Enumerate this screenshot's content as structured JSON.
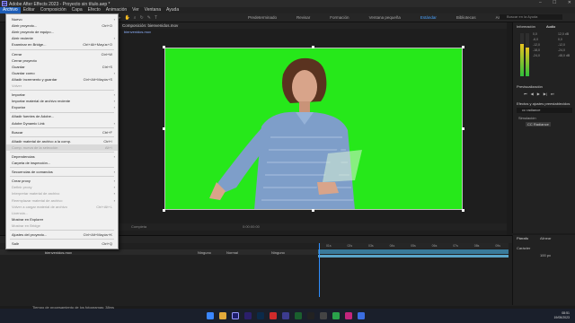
{
  "app": {
    "window_title": "Adobe After Effects 2023 - Proyecto sin título.aep *",
    "logo_text": "Ae"
  },
  "menubar": [
    "Archivo",
    "Editar",
    "Composición",
    "Capa",
    "Efecto",
    "Animación",
    "Ver",
    "Ventana",
    "Ayuda"
  ],
  "workspaces": [
    "Predeterminado",
    "Revisar",
    "Formación",
    "Ventana pequeña",
    "Estándar",
    "Bibliotecas",
    "Animación Mediapipe",
    "Tagging"
  ],
  "active_workspace_index": 4,
  "search_placeholder": "Buscar en la Ayuda",
  "composition": {
    "tab": "Composición: bienvenidos.mov",
    "sub": "bienvenidos.mov",
    "zoom": "Completa",
    "timecode": "0:00:00:00"
  },
  "right_panels": {
    "info_tab": "Información",
    "audio_tab": "Audio",
    "audio_scale": [
      "0,0",
      "-3,0",
      "-6,0",
      "-9,0",
      "-12,0",
      "-15,0",
      "-18,0",
      "-21,0",
      "-24,0"
    ],
    "audio_scale_right": [
      "12,0 dB",
      "0,0",
      "-12,0",
      "-24,0",
      "-36,0",
      "-48,0 dB"
    ],
    "preview_tab": "Previsualización",
    "effects_tab": "Efectos y ajustes preestablecidos",
    "effects_search": "cc radiance",
    "effect_group": "Simulación",
    "effect_item": "CC Radiance"
  },
  "timeline": {
    "layer_name": "bienvenidos.mov",
    "col_labels": [
      "Ninguno",
      "Normal",
      "Ninguno"
    ],
    "status_text": "Tiempo de procesamiento de los fotogramas: 38ms",
    "ruler": [
      "01s",
      "02s",
      "03s",
      "04s",
      "05s",
      "06s",
      "07s",
      "08s",
      "09s"
    ]
  },
  "right_bottom": {
    "tab1": "Párrafo",
    "tab2": "Alinear",
    "tab3": "Carácter",
    "val": "100 px"
  },
  "clock": {
    "time": "08:51",
    "date": "19/05/2023"
  },
  "file_menu": [
    {
      "label": "Nuevo",
      "sc": "",
      "arrow": true,
      "dis": false
    },
    {
      "label": "Abrir proyecto...",
      "sc": "Ctrl+O",
      "arrow": false,
      "dis": false
    },
    {
      "label": "Abrir proyecto de equipo...",
      "sc": "",
      "arrow": false,
      "dis": false
    },
    {
      "label": "Abrir reciente",
      "sc": "",
      "arrow": true,
      "dis": false
    },
    {
      "label": "Examinar en Bridge...",
      "sc": "Ctrl+Alt+Mayús+O",
      "arrow": false,
      "dis": false
    },
    {
      "sep": true
    },
    {
      "label": "Cerrar",
      "sc": "Ctrl+W",
      "arrow": false,
      "dis": false
    },
    {
      "label": "Cerrar proyecto",
      "sc": "",
      "arrow": false,
      "dis": false
    },
    {
      "label": "Guardar",
      "sc": "Ctrl+S",
      "arrow": false,
      "dis": false
    },
    {
      "label": "Guardar como",
      "sc": "",
      "arrow": true,
      "dis": false
    },
    {
      "label": "Añadir incremento y guardar",
      "sc": "Ctrl+Alt+Mayús+S",
      "arrow": false,
      "dis": false
    },
    {
      "label": "Volver",
      "sc": "",
      "arrow": false,
      "dis": true
    },
    {
      "sep": true
    },
    {
      "label": "Importar",
      "sc": "",
      "arrow": true,
      "dis": false
    },
    {
      "label": "Importar material de archivo reciente",
      "sc": "",
      "arrow": true,
      "dis": false
    },
    {
      "label": "Exportar",
      "sc": "",
      "arrow": true,
      "dis": false
    },
    {
      "sep": true
    },
    {
      "label": "Añadir fuentes de Adobe...",
      "sc": "",
      "arrow": false,
      "dis": false
    },
    {
      "label": "Adobe Dynamic Link",
      "sc": "",
      "arrow": true,
      "dis": false
    },
    {
      "sep": true
    },
    {
      "label": "Buscar",
      "sc": "Ctrl+F",
      "arrow": false,
      "dis": false
    },
    {
      "sep": true
    },
    {
      "label": "Añadir material de archivo a la comp.",
      "sc": "Ctrl+/",
      "arrow": false,
      "dis": false
    },
    {
      "label": "Comp. nueva de la selección",
      "sc": "Alt+\\",
      "arrow": false,
      "dis": true,
      "hl": true
    },
    {
      "sep": true
    },
    {
      "label": "Dependencias",
      "sc": "",
      "arrow": true,
      "dis": false
    },
    {
      "label": "Carpeta de inspección...",
      "sc": "",
      "arrow": false,
      "dis": false
    },
    {
      "sep": true
    },
    {
      "label": "Secuencias de comandos",
      "sc": "",
      "arrow": true,
      "dis": false
    },
    {
      "sep": true
    },
    {
      "label": "Crear proxy",
      "sc": "",
      "arrow": true,
      "dis": false
    },
    {
      "label": "Definir proxy",
      "sc": "",
      "arrow": true,
      "dis": true
    },
    {
      "label": "Interpretar material de archivo",
      "sc": "",
      "arrow": true,
      "dis": true
    },
    {
      "label": "Reemplazar material de archivo",
      "sc": "",
      "arrow": true,
      "dis": true
    },
    {
      "label": "Volver a cargar material de archivo",
      "sc": "Ctrl+Alt+L",
      "arrow": false,
      "dis": true
    },
    {
      "label": "Licencia...",
      "sc": "",
      "arrow": false,
      "dis": true
    },
    {
      "label": "Mostrar en Explorer",
      "sc": "",
      "arrow": false,
      "dis": false
    },
    {
      "label": "Mostrar en Bridge",
      "sc": "",
      "arrow": false,
      "dis": true
    },
    {
      "sep": true
    },
    {
      "label": "Ajustes del proyecto...",
      "sc": "Ctrl+Alt+Mayús+K",
      "arrow": false,
      "dis": false
    },
    {
      "sep": true
    },
    {
      "label": "Salir",
      "sc": "Ctrl+Q",
      "arrow": false,
      "dis": false
    }
  ]
}
